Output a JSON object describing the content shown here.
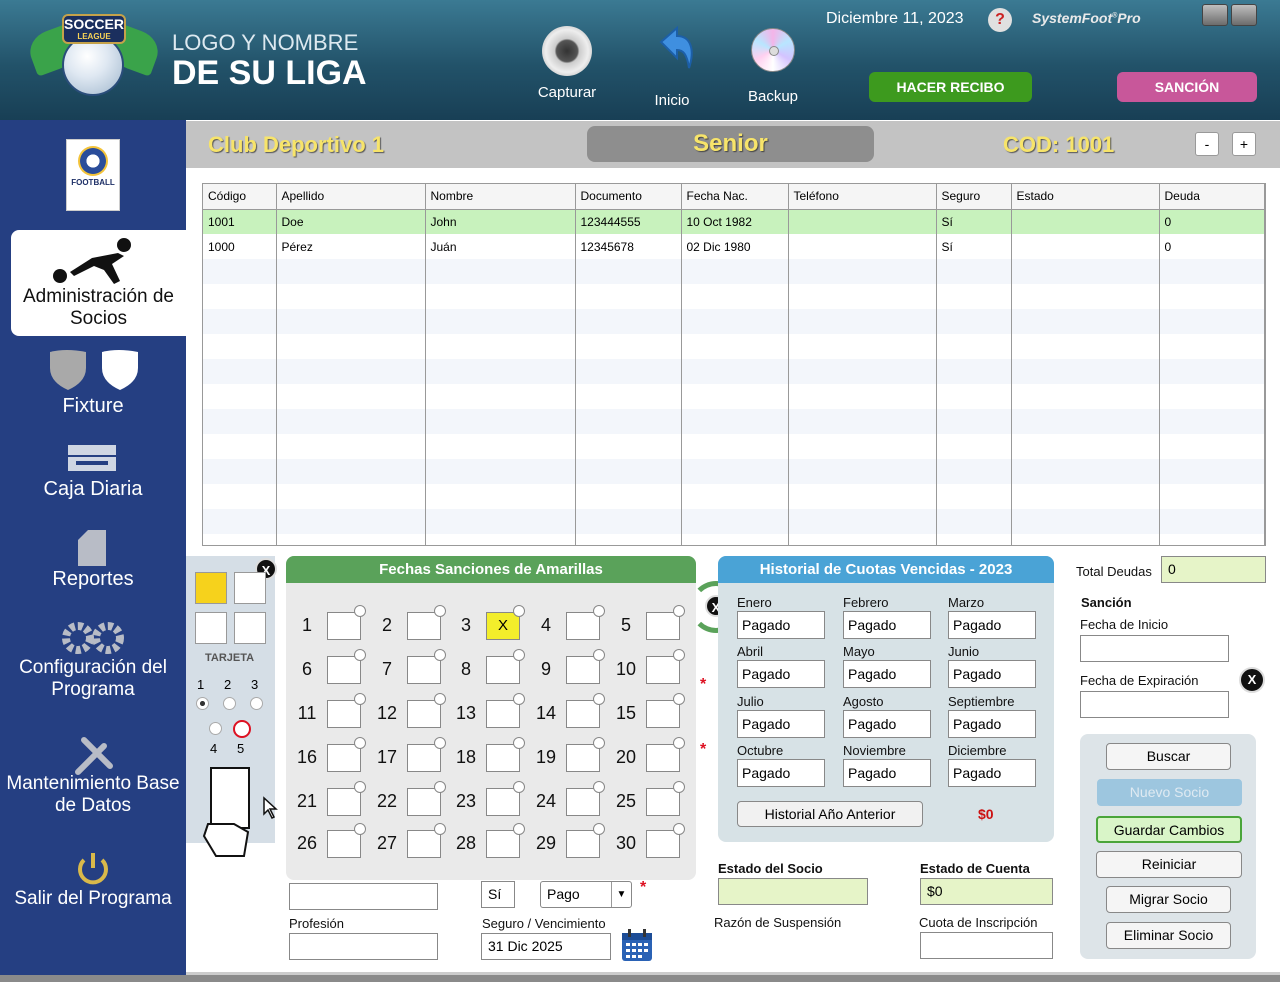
{
  "header": {
    "league_logo_top": "SOCCER",
    "league_logo_sub": "LEAGUE",
    "league_name_line1": "LOGO Y NOMBRE",
    "league_name_line2": "DE SU LIGA",
    "capture_label": "Capturar",
    "home_label": "Inicio",
    "backup_label": "Backup",
    "date": "Diciembre 11, 2023",
    "help_symbol": "?",
    "brand": "SystemFoot",
    "brand_sup": "®",
    "brand_suffix": "Pro",
    "receipt_button": "HACER RECIBO",
    "sanction_button": "SANCIÓN",
    "receipt_color": "#3d9a1e",
    "sanction_color": "#c8579a"
  },
  "sidebar": {
    "club_badge_text": "FOOTBALL",
    "items": [
      {
        "label": "Administración de Socios",
        "icon": "soccer-player-icon"
      },
      {
        "label": "Fixture",
        "icon": "shields-icon"
      },
      {
        "label": "Caja Diaria",
        "icon": "cash-register-icon"
      },
      {
        "label": "Reportes",
        "icon": "document-icon"
      },
      {
        "label": "Configuración del Programa",
        "icon": "gears-icon"
      },
      {
        "label": "Mantenimiento Base de Datos",
        "icon": "tools-icon"
      },
      {
        "label": "Salir del Programa",
        "icon": "power-icon"
      }
    ]
  },
  "titlebar": {
    "club": "Club Deportivo 1",
    "category": "Senior",
    "cod_label": "COD:",
    "cod_value": "1001",
    "minus": "-",
    "plus": "+"
  },
  "table": {
    "columns": [
      "Código",
      "Apellido",
      "Nombre",
      "Documento",
      "Fecha Nac.",
      "Teléfono",
      "Seguro",
      "Estado",
      "Deuda"
    ],
    "rows": [
      [
        "1001",
        "Doe",
        "John",
        "123444555",
        "10 Oct 1982",
        "",
        "Sí",
        "",
        "0"
      ],
      [
        "1000",
        "Pérez",
        "Juán",
        "12345678",
        "02 Dic 1980",
        "",
        "Sí",
        "",
        "0"
      ]
    ]
  },
  "cards": {
    "close": "X",
    "label": "TARJETA",
    "options": [
      "1",
      "2",
      "3",
      "4",
      "5"
    ],
    "yellow": "#f6d21c"
  },
  "sanctions": {
    "title": "Fechas Sanciones de Amarillas",
    "close": "X",
    "mark": "X",
    "marked_date": "3",
    "dates": [
      "1",
      "2",
      "3",
      "4",
      "5",
      "6",
      "7",
      "8",
      "9",
      "10",
      "11",
      "12",
      "13",
      "14",
      "15",
      "16",
      "17",
      "18",
      "19",
      "20",
      "21",
      "22",
      "23",
      "24",
      "25",
      "26",
      "27",
      "28",
      "29",
      "30"
    ]
  },
  "history": {
    "title": "Historial de Cuotas Vencidas - 2023",
    "months": [
      "Enero",
      "Febrero",
      "Marzo",
      "Abril",
      "Mayo",
      "Junio",
      "Julio",
      "Agosto",
      "Septiembre",
      "Octubre",
      "Noviembre",
      "Diciembre"
    ],
    "statuses": [
      "Pagado",
      "Pagado",
      "Pagado",
      "Pagado",
      "Pagado",
      "Pagado",
      "Pagado",
      "Pagado",
      "Pagado",
      "Pagado",
      "Pagado",
      "Pagado"
    ],
    "prev_year_button": "Historial Año Anterior",
    "amount": "$0"
  },
  "right": {
    "total_label": "Total Deudas",
    "total_value": "0",
    "sanction_label": "Sanción",
    "start_label": "Fecha de Inicio",
    "start_value": "",
    "expiry_label": "Fecha de Expiración",
    "expiry_value": "",
    "close": "X"
  },
  "actions": {
    "search": "Buscar",
    "new": "Nuevo Socio",
    "save": "Guardar Cambios",
    "reset": "Reiniciar",
    "migrate": "Migrar Socio",
    "delete": "Eliminar Socio"
  },
  "form": {
    "field1_value": "",
    "profession_label": "Profesión",
    "profession_value": "",
    "insurance_yes": "Sí",
    "payment_select": "Pago",
    "insurance_label": "Seguro / Vencimiento",
    "insurance_value": "31 Dic 2025",
    "status_label": "Estado del Socio",
    "status_value": "",
    "suspension_label": "Razón de Suspensión",
    "account_label": "Estado de Cuenta",
    "account_value": "$0",
    "fee_label": "Cuota de Inscripción",
    "fee_value": "",
    "required_mark": "*"
  }
}
